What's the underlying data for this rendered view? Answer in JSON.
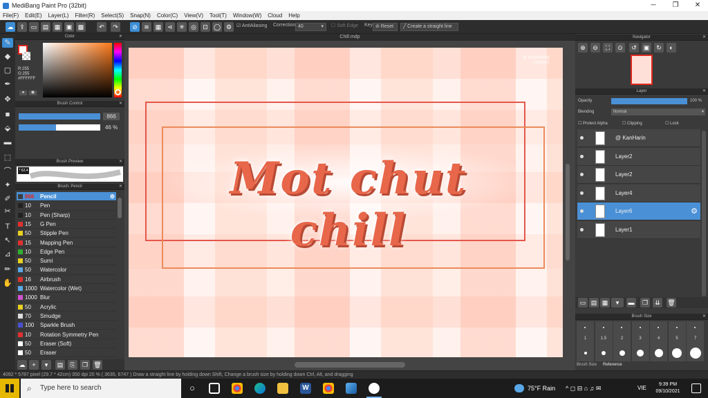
{
  "window": {
    "title": "MediBang Paint Pro (32bit)"
  },
  "menu": [
    "File(F)",
    "Edit(E)",
    "Layer(L)",
    "Filter(R)",
    "Select(S)",
    "Snap(N)",
    "Color(C)",
    "View(V)",
    "Tool(T)",
    "Window(W)",
    "Cloud",
    "Help"
  ],
  "toolbar": {
    "antialiasing": "AntiAliasing",
    "correction_label": "Correction",
    "correction_value": "40",
    "soft_edge": "Soft Edge",
    "key": "Key",
    "reset": "Reset",
    "straight_line": "Create a straight line"
  },
  "color_panel": {
    "title": "Color",
    "readout_r": "R:255",
    "readout_g": "G:255",
    "readout_hex": "#FFFFFF",
    "fg": "#ffffff",
    "accent": "#e0281e"
  },
  "brush_control": {
    "title": "Brush Control",
    "size": "866",
    "opacity": "46 %",
    "opacity_fraction": 0.46
  },
  "brush_preview": {
    "title": "Brush Preview",
    "size_readout": "* 62.4"
  },
  "brush_list": {
    "title": "Brush: Pencil",
    "items": [
      {
        "size": "866",
        "name": "Pencil",
        "color": "#3d3d3d",
        "selected": true
      },
      {
        "size": "10",
        "name": "Pen",
        "color": "#222222"
      },
      {
        "size": "10",
        "name": "Pen (Sharp)",
        "color": "#222222"
      },
      {
        "size": "15",
        "name": "G Pen",
        "color": "#e03030"
      },
      {
        "size": "50",
        "name": "Stipple Pen",
        "color": "#e8d020"
      },
      {
        "size": "15",
        "name": "Mapping Pen",
        "color": "#e03030"
      },
      {
        "size": "10",
        "name": "Edge Pen",
        "color": "#30b030"
      },
      {
        "size": "50",
        "name": "Sumi",
        "color": "#e8d020"
      },
      {
        "size": "50",
        "name": "Watercolor",
        "color": "#5aa8e8"
      },
      {
        "size": "16",
        "name": "Airbrush",
        "color": "#e03030"
      },
      {
        "size": "1000",
        "name": "Watercolor (Wet)",
        "color": "#5aa8e8"
      },
      {
        "size": "1000",
        "name": "Blur",
        "color": "#d050d0"
      },
      {
        "size": "50",
        "name": "Acrylic",
        "color": "#e8d020"
      },
      {
        "size": "70",
        "name": "Smudge",
        "color": "#dddddd"
      },
      {
        "size": "100",
        "name": "Sparkle Brush",
        "color": "#4a50d0"
      },
      {
        "size": "10",
        "name": "Rotation Symmetry Pen",
        "color": "#e03030"
      },
      {
        "size": "50",
        "name": "Eraser (Soft)",
        "color": "#ffffff"
      },
      {
        "size": "50",
        "name": "Eraser",
        "color": "#ffffff"
      }
    ]
  },
  "document": {
    "tab": "Chill.mdp",
    "artwork_text": "Mot chut chill",
    "watermark_line1": "@ KANHARIN",
    "watermark_line2": "#4d2b47",
    "text_color": "#e8674a"
  },
  "navigator": {
    "title": "Navigator"
  },
  "layer_panel": {
    "title": "Layer",
    "opacity_label": "Opacity",
    "opacity_value": "100 %",
    "blending_label": "Blending",
    "blending_value": "Normal",
    "protect_alpha": "Protect Alpha",
    "clipping": "Clipping",
    "lock": "Lock",
    "layers": [
      {
        "name": "@ KanHarin",
        "selected": false
      },
      {
        "name": "Layer2",
        "selected": false
      },
      {
        "name": "Layer2",
        "selected": false
      },
      {
        "name": "Layer4",
        "selected": false
      },
      {
        "name": "Layer6",
        "selected": true
      },
      {
        "name": "Layer1",
        "selected": false
      }
    ]
  },
  "brush_size": {
    "title": "Brush Size",
    "sizes": [
      "1",
      "1.5",
      "2",
      "3",
      "4",
      "5",
      "7"
    ],
    "tabs": [
      "Brush Size",
      "Reference"
    ]
  },
  "status": "4092 * 5787 pixel  (29.7 * 42cm)  350 dpi  20 %  ( 3635, 6747 )  Draw a straight line by holding down Shift, Change a brush size by holding down Ctrl, Alt, and dragging",
  "taskbar": {
    "search_placeholder": "Type here to search",
    "weather": "75°F Rain",
    "lang": "VIE",
    "time": "9:39 PM",
    "date": "09/10/2021"
  }
}
